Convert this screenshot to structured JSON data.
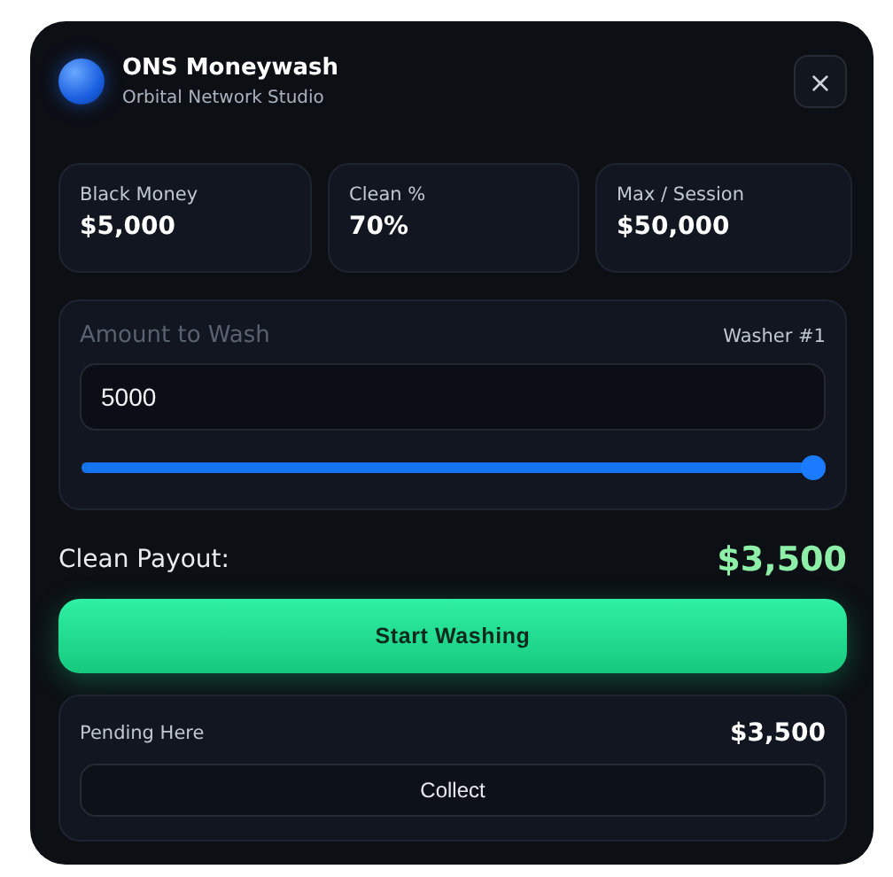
{
  "header": {
    "title": "ONS Moneywash",
    "subtitle": "Orbital Network Studio",
    "close": "×"
  },
  "stats": [
    {
      "label": "Black Money",
      "value": "$5,000"
    },
    {
      "label": "Clean %",
      "value": "70%"
    },
    {
      "label": "Max / Session",
      "value": "$50,000"
    }
  ],
  "wash": {
    "label": "Amount to Wash",
    "washer": "Washer #1",
    "amount": "5000",
    "level": 1
  },
  "payout": {
    "label": "Clean Payout:",
    "value": "$3,500"
  },
  "start_button": "Start Washing",
  "pending": {
    "label": "Pending Here",
    "value": "$3,500",
    "button": "Collect"
  }
}
